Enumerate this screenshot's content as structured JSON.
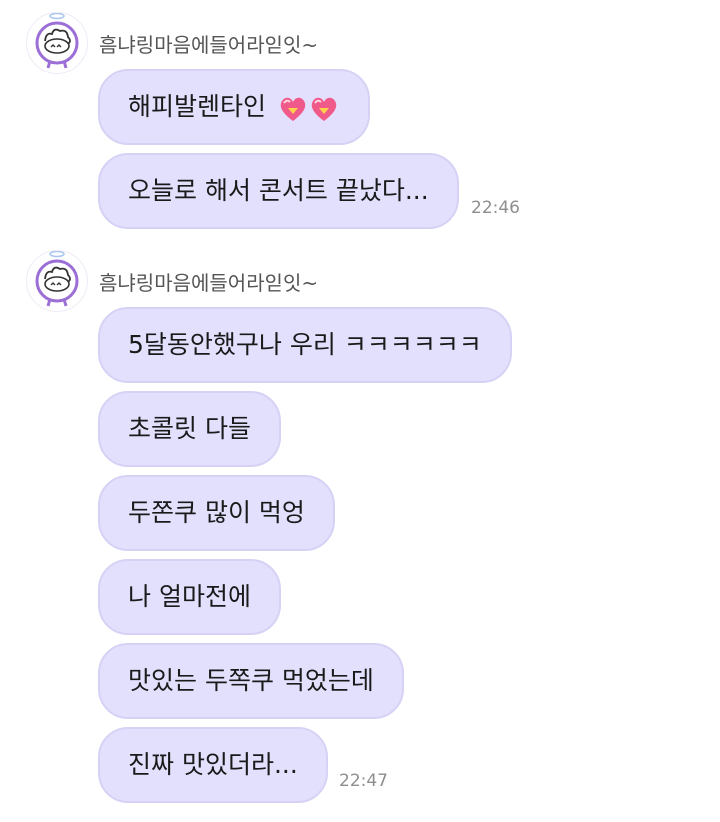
{
  "groups": [
    {
      "sender": "흠냐링마음에들어라읻잇~",
      "messages": [
        {
          "text": "해피발렌타인",
          "emoji": "heart-emoji"
        },
        {
          "text": "오늘로 해서 콘서트 끝났다..."
        }
      ],
      "time": "22:46"
    },
    {
      "sender": "흠냐링마음에들어라읻잇~",
      "messages": [
        {
          "text": "5달동안했구나 우리 ㅋㅋㅋㅋㅋㅋ"
        },
        {
          "text": "초콜릿 다들"
        },
        {
          "text": "두쫀쿠 많이 먹엉"
        },
        {
          "text": "나 얼마전에"
        },
        {
          "text": "맛있는 두쪽쿠 먹었는데"
        },
        {
          "text": "진짜 맛있더라..."
        }
      ],
      "time": "22:47"
    }
  ],
  "colors": {
    "bubble": "#e3e0fd",
    "bubble_border": "#d6d2f6",
    "avatar_accent": "#9b6fd6",
    "heart": "#f05a8a"
  }
}
